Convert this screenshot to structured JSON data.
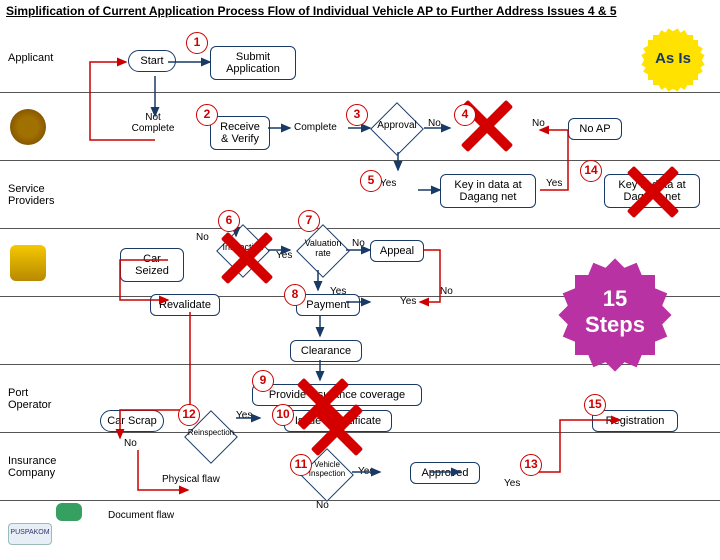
{
  "title": "Simplification of Current Application Process Flow of Individual Vehicle AP to Further Address Issues 4 & 5",
  "asis": "As Is",
  "bigstar": {
    "line1": "15",
    "line2": "Steps"
  },
  "lanes": {
    "applicant": "Applicant",
    "service": "Service\nProviders",
    "port": "Port\nOperator",
    "insurance": "Insurance\nCompany"
  },
  "nodes": {
    "start": "Start",
    "submit": "Submit\nApplication",
    "notcomplete": "Not\nComplete",
    "receive": "Receive\n& Verify",
    "complete": "Complete",
    "approval": "Approval",
    "noap": "No AP",
    "keyin": "Key in data at\nDagang net",
    "keyin2": "Key in data at\nDagang net",
    "carseized": "Car Seized",
    "inspection": "Inspection",
    "valuation": "Valuation\nrate",
    "appeal": "Appeal",
    "revalidate": "Revalidate",
    "payment": "Payment",
    "clearance": "Clearance",
    "provinsur": "Provide insurance coverage",
    "carscrap": "Car Scrap",
    "reinspect": "Reinspection",
    "issuevc": "Issue VCertificate",
    "physflaw": "Physical flaw",
    "docflaw": "Document flaw",
    "vehinsp": "Vehicle\nInspection",
    "approved": "Approved",
    "registration": "Registration"
  },
  "labels": {
    "no": "No",
    "yes": "Yes"
  },
  "nums": {
    "n1": "1",
    "n2": "2",
    "n3": "3",
    "n4": "4",
    "n5": "5",
    "n6": "6",
    "n7": "7",
    "n8": "8",
    "n9": "9",
    "n10": "10",
    "n11": "11",
    "n12": "12",
    "n13": "13",
    "n14": "14",
    "n15": "15"
  }
}
